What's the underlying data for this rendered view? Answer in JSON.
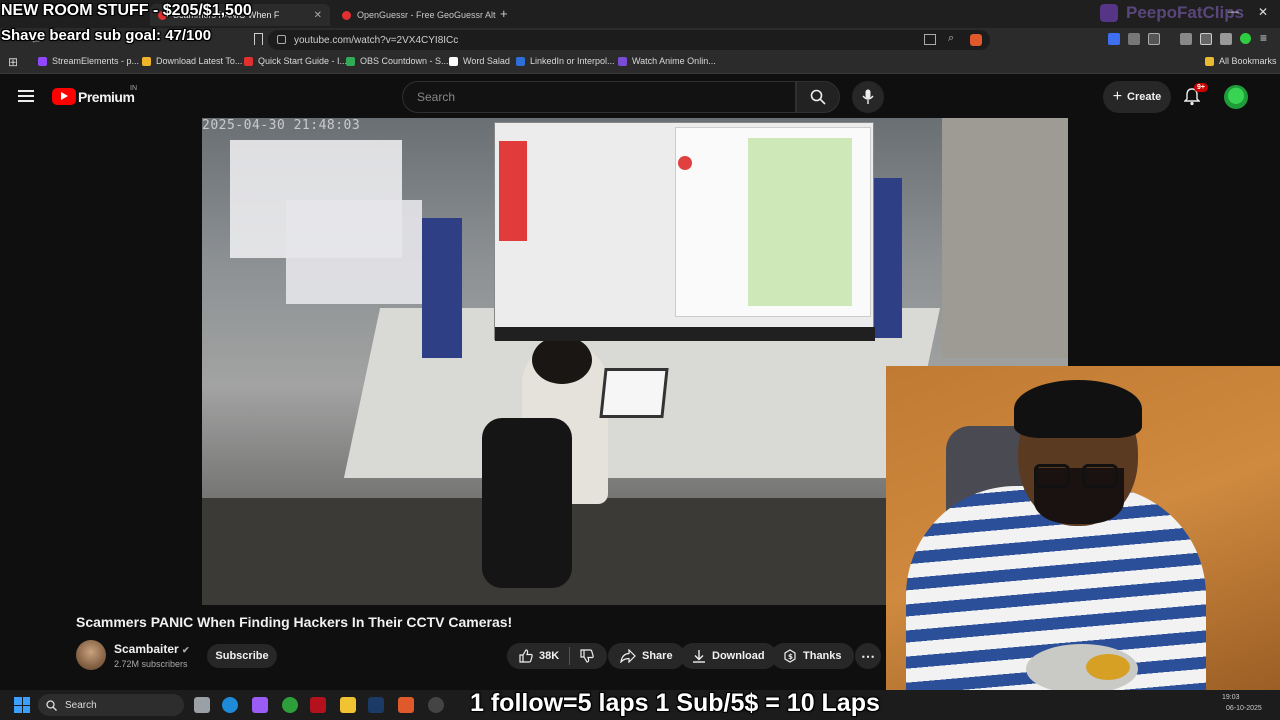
{
  "overlay": {
    "room_goal": "NEW ROOM STUFF - $205/$1,500",
    "shave_goal": "Shave beard sub goal: 47/100",
    "laps": "1 follow=5 laps 1 Sub/5$ = 10 Laps",
    "watermark": "PeepoFatClips"
  },
  "tabs": [
    {
      "label": "Scammers PANIC When F",
      "active": true
    },
    {
      "label": "OpenGuessr - Free GeoGuessr Altern",
      "active": false
    }
  ],
  "address": {
    "url": "youtube.com/watch?v=2VX4CYI8ICc"
  },
  "bookmarks": [
    {
      "label": "StreamElements - p...",
      "color": "#9146ff"
    },
    {
      "label": "Download Latest To...",
      "color": "#f0b429"
    },
    {
      "label": "Quick Start Guide - I...",
      "color": "#e03030"
    },
    {
      "label": "OBS Countdown - S...",
      "color": "#33aa55"
    },
    {
      "label": "Word Salad",
      "color": "#ffffff"
    },
    {
      "label": "LinkedIn or Interpol...",
      "color": "#2d6fd6"
    },
    {
      "label": "Watch Anime Onlin...",
      "color": "#7a4cd6"
    }
  ],
  "all_bookmarks": "All Bookmarks",
  "youtube": {
    "logo_text": "Premium",
    "region": "IN",
    "search_placeholder": "Search",
    "create_label": "Create",
    "notif_count": "9+"
  },
  "video_overlay": {
    "timestamp": "2025-04-30 21:48:03"
  },
  "video": {
    "title": "Scammers PANIC When Finding Hackers In Their CCTV Cameras!",
    "channel": "Scambaiter",
    "subscribers": "2.72M subscribers",
    "subscribe_label": "Subscribe",
    "likes": "38K",
    "share_label": "Share",
    "download_label": "Download",
    "thanks_label": "Thanks"
  },
  "taskbar": {
    "search_label": "Search",
    "time": "19:03",
    "date": "06-10-2025"
  },
  "colors": {
    "accent": "#ff0000",
    "bg": "#0f0f0f"
  }
}
